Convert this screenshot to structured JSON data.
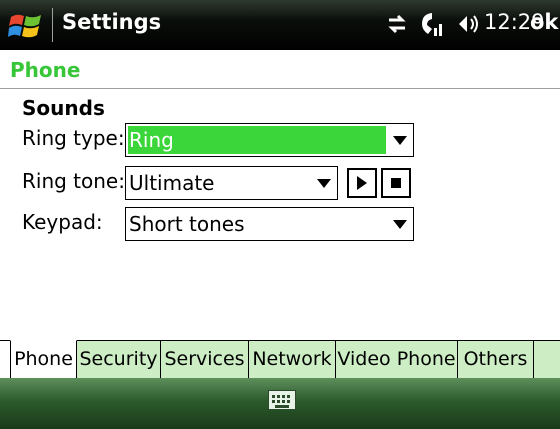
{
  "titlebar": {
    "title": "Settings",
    "time": "12:29",
    "ok_label": "ok",
    "icons": [
      "windows-start-icon",
      "connectivity-icon",
      "signal-icon",
      "volume-icon"
    ]
  },
  "page": {
    "header": "Phone",
    "section_title": "Sounds"
  },
  "fields": {
    "ring_type": {
      "label": "Ring type:",
      "value": "Ring"
    },
    "ring_tone": {
      "label": "Ring tone:",
      "value": "Ultimate"
    },
    "keypad": {
      "label": "Keypad:",
      "value": "Short tones"
    }
  },
  "tabs": [
    {
      "label": "Phone",
      "active": true
    },
    {
      "label": "Security",
      "active": false
    },
    {
      "label": "Services",
      "active": false
    },
    {
      "label": "Network",
      "active": false
    },
    {
      "label": "Video Phone",
      "active": false
    },
    {
      "label": "Others",
      "active": false
    }
  ],
  "bottombar": {
    "icons": [
      "keyboard-icon"
    ]
  },
  "colors": {
    "accent_green": "#37c637",
    "selection_green": "#3ad63a",
    "tab_green": "#cdeec4",
    "titlebar_black": "#000000"
  }
}
